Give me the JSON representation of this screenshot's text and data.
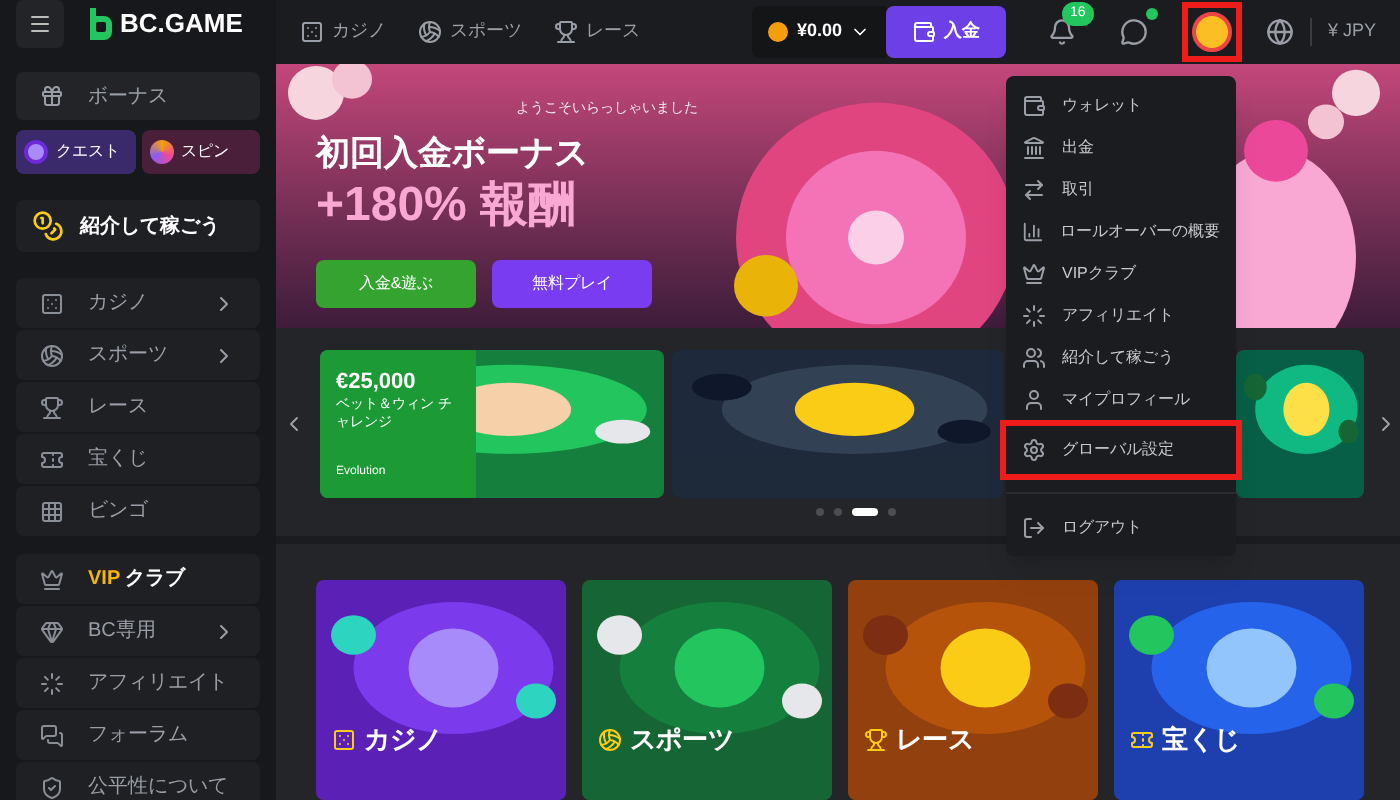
{
  "brand": {
    "name": "BC.GAME"
  },
  "top_nav": [
    {
      "label": "カジノ",
      "kind": "casino"
    },
    {
      "label": "スポーツ",
      "kind": "sports"
    },
    {
      "label": "レース",
      "kind": "racing"
    }
  ],
  "header": {
    "balance": "¥0.00",
    "deposit": "入金",
    "notifications": "16",
    "chat_online": true,
    "avatar_highlighted": true,
    "currency": "¥ JPY"
  },
  "sidebar": {
    "bonus": "ボーナス",
    "quest": "クエスト",
    "spin": "スピン",
    "referral": "紹介して稼ごう",
    "items": [
      {
        "label": "カジノ",
        "kind": "casino",
        "has_submenu": true
      },
      {
        "label": "スポーツ",
        "kind": "sports",
        "has_submenu": true
      },
      {
        "label": "レース",
        "kind": "racing",
        "has_submenu": false
      },
      {
        "label": "宝くじ",
        "kind": "lottery",
        "has_submenu": false
      },
      {
        "label": "ビンゴ",
        "kind": "bingo",
        "has_submenu": false
      }
    ],
    "vip": {
      "prefix": "VIP",
      "label": "クラブ"
    },
    "items2": [
      {
        "label": "BC専用",
        "kind": "bc",
        "has_submenu": true
      },
      {
        "label": "アフィリエイト",
        "kind": "affiliate",
        "has_submenu": false
      },
      {
        "label": "フォーラム",
        "kind": "forum",
        "has_submenu": false
      },
      {
        "label": "公平性について",
        "kind": "fair",
        "has_submenu": false
      }
    ]
  },
  "hero": {
    "greeting": "ようこそいらっしゃいました",
    "title": "初回入金ボーナス",
    "bonus": "+180% 報酬",
    "primary_button": "入金&遊ぶ",
    "secondary_button": "無料プレイ"
  },
  "promo": {
    "amount": "€25,000",
    "subtitle": "ベット＆ウィン チャレンジ",
    "provider": "Evolution",
    "slides": [
      {
        "selected": false
      },
      {
        "selected": false
      },
      {
        "selected": true
      },
      {
        "selected": false
      }
    ]
  },
  "categories": [
    {
      "title": "カジノ",
      "kind": "casino"
    },
    {
      "title": "スポーツ",
      "kind": "sports"
    },
    {
      "title": "レース",
      "kind": "racing"
    },
    {
      "title": "宝くじ",
      "kind": "lottery"
    }
  ],
  "user_menu": [
    {
      "label": "ウォレット",
      "kind": "wallet",
      "highlighted": false,
      "separated": false
    },
    {
      "label": "出金",
      "kind": "withdraw",
      "highlighted": false,
      "separated": false
    },
    {
      "label": "取引",
      "kind": "transactions",
      "highlighted": false,
      "separated": false
    },
    {
      "label": "ロールオーバーの概要",
      "kind": "chart",
      "highlighted": false,
      "separated": false
    },
    {
      "label": "VIPクラブ",
      "kind": "vip",
      "highlighted": false,
      "separated": false
    },
    {
      "label": "アフィリエイト",
      "kind": "affiliate",
      "highlighted": false,
      "separated": false
    },
    {
      "label": "紹介して稼ごう",
      "kind": "people",
      "highlighted": false,
      "separated": false
    },
    {
      "label": "マイプロフィール",
      "kind": "user",
      "highlighted": false,
      "separated": false
    },
    {
      "label": "グローバル設定",
      "kind": "settings",
      "highlighted": true,
      "separated": false
    },
    {
      "label": "ログアウト",
      "kind": "logout",
      "highlighted": false,
      "separated": true
    }
  ]
}
